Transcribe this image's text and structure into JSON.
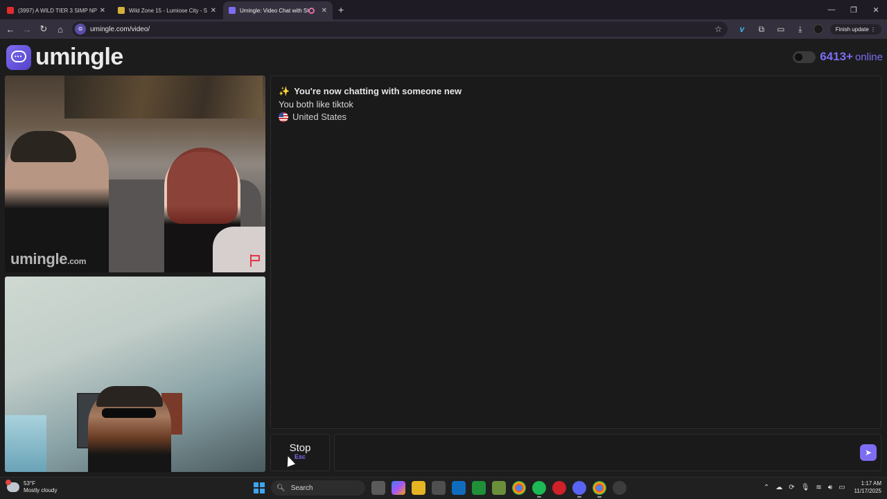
{
  "browser": {
    "tabs": [
      {
        "title": "(3997) A WILD TIER 3 SIMP NP",
        "favicon_color": "#e22b2b",
        "active": false
      },
      {
        "title": "Wild Zone 15 - Lumiose City - S",
        "favicon_color": "#d4b13a",
        "active": false
      },
      {
        "title": "Umingle: Video Chat with St",
        "favicon_color": "#7c6df2",
        "active": true
      }
    ],
    "address": "umingle.com/video/",
    "finish_update": "Finish update"
  },
  "site": {
    "logo_text": "umingle",
    "online_count": "6413+",
    "online_label": "online",
    "accent_color": "#7c6df2"
  },
  "videos": {
    "stranger_watermark": "umingle",
    "stranger_watermark_suffix": ".com"
  },
  "chat": {
    "sparkle": "✨",
    "title": "You're now chatting with someone new",
    "interest": "You both like tiktok",
    "country": "United States"
  },
  "controls": {
    "stop_label": "Stop",
    "stop_key": "Esc",
    "message_placeholder": ""
  },
  "taskbar": {
    "temperature": "53°F",
    "weather": "Mostly cloudy",
    "search_label": "Search",
    "time": "1:17 AM",
    "date": "11/17/2025"
  }
}
